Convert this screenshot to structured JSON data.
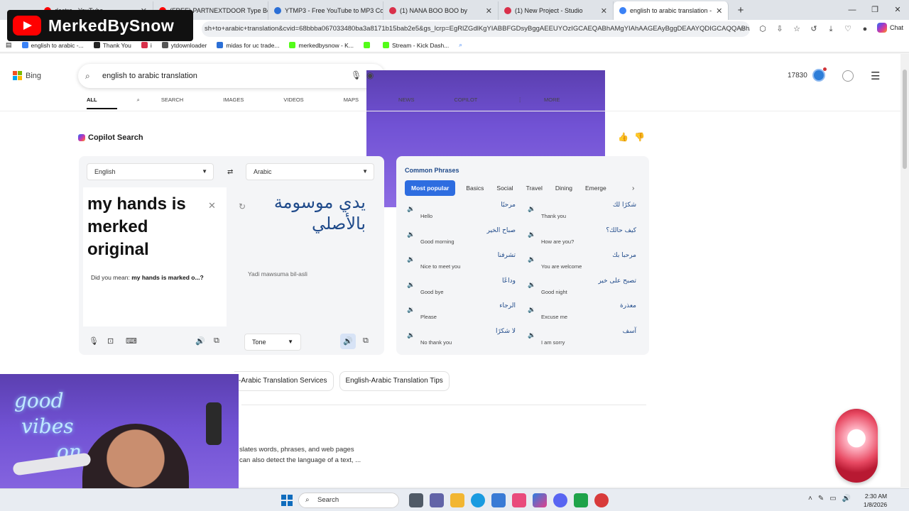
{
  "browser": {
    "tabs": [
      {
        "label": "destro - YouTube",
        "color": "#ff0000"
      },
      {
        "label": "(FREE) PARTNEXTDOOR Type Beat",
        "color": "#ff0000"
      },
      {
        "label": "YTMP3 - Free YouTube to MP3 Co",
        "color": "#2b6fd6"
      },
      {
        "label": "(1) NANA BOO BOO by",
        "color": "#d9304a"
      },
      {
        "label": "(1) New Project - Studio",
        "color": "#d9304a"
      },
      {
        "label": "english to arabic translation -",
        "color": "#3b82f6"
      }
    ],
    "new_tab": "+",
    "window": {
      "minimize": "—",
      "restore": "❐",
      "close": "✕"
    },
    "url": "sh+to+arabic+translation&cvid=68bbba067033480ba3a8171b15bab2e5&gs_lcrp=EgRlZGdlKgYIABBFGDsyBggAEEUYOzIGCAEQABhAMgYIAhAAGEAyBggDEAAYQDIGCAQQABhAMgY...",
    "chat_label": "Chat",
    "bookmarks": [
      "english to arabic -...",
      "Thank You",
      "i",
      "ytdownloader",
      "midas for uc trade...",
      "merkedbysnow - K...",
      "",
      "Stream - Kick Dash..."
    ]
  },
  "bing": {
    "logo": "Bing",
    "query": "english to arabic translation",
    "points": "17830",
    "nav": [
      "ALL",
      "SEARCH",
      "IMAGES",
      "VIDEOS",
      "MAPS",
      "NEWS",
      "COPILOT",
      "MORE"
    ],
    "copilot_title": "Copilot Search"
  },
  "translator": {
    "source_lang": "English",
    "target_lang": "Arabic",
    "source_text": "my hands is merked original",
    "did_you_mean_prefix": "Did you mean:",
    "did_you_mean": "my hands is marked o...?",
    "arabic_text": "يدي موسومة بالأصلي",
    "transliteration": "Yadi mawsuma bil-asli",
    "tone_label": "Tone"
  },
  "phrases": {
    "title": "Common Phrases",
    "tabs": [
      "Most popular",
      "Basics",
      "Social",
      "Travel",
      "Dining",
      "Emerge"
    ],
    "items": [
      {
        "ar": "مرحبًا",
        "en": "Hello"
      },
      {
        "ar": "شكرًا لك",
        "en": "Thank you"
      },
      {
        "ar": "صباح الخير",
        "en": "Good morning"
      },
      {
        "ar": "كيف حالك؟",
        "en": "How are you?"
      },
      {
        "ar": "تشرفنا",
        "en": "Nice to meet you"
      },
      {
        "ar": "مرحبا بك",
        "en": "You are welcome"
      },
      {
        "ar": "وداعًا",
        "en": "Good bye"
      },
      {
        "ar": "تصبح على خير",
        "en": "Good night"
      },
      {
        "ar": "الرجاء",
        "en": "Please"
      },
      {
        "ar": "معذرة",
        "en": "Excuse me"
      },
      {
        "ar": "لا شكرًا",
        "en": "No thank you"
      },
      {
        "ar": "آسف",
        "en": "I am sorry"
      }
    ]
  },
  "related": {
    "chips": [
      "-Arabic Translation Services",
      "English-Arabic Translation Tips"
    ],
    "snippet_line1": "slates words, phrases, and web pages",
    "snippet_line2": "can also detect the language of a text, ..."
  },
  "overlay": {
    "channel_name": "MerkedBySnow",
    "neon_line1": "good",
    "neon_line2": "vibes",
    "neon_line3": "on"
  },
  "taskbar": {
    "search_label": "Search",
    "time": "2:30 AM",
    "date": "1/8/2026"
  }
}
